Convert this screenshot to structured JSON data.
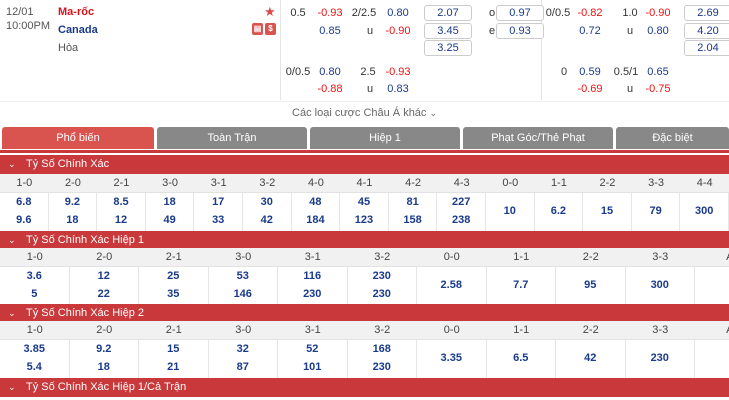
{
  "match": {
    "date": "12/01",
    "time": "10:00PM",
    "home": "Ma-rốc",
    "away": "Canada",
    "draw": "Hòa",
    "badge1": "▤",
    "badge2": "$"
  },
  "odds_block1": {
    "r1": [
      "0.5",
      "-0.93",
      "2/2.5",
      "0.80",
      "2.07",
      "o",
      "0.97"
    ],
    "r2": [
      "0.85",
      "u",
      "-0.90",
      "3.45",
      "e",
      "0.93"
    ],
    "r3": [
      "3.25"
    ],
    "r4": [
      "0/0.5",
      "0.80",
      "2.5",
      "-0.93"
    ],
    "r5": [
      "-0.88",
      "u",
      "0.83"
    ]
  },
  "odds_block2": {
    "r1": [
      "0/0.5",
      "-0.82",
      "1.0",
      "-0.90",
      "2.69"
    ],
    "r2": [
      "0.72",
      "u",
      "0.80",
      "4.20"
    ],
    "r3": [
      "2.04"
    ],
    "r4": [
      "0",
      "0.59",
      "0.5/1",
      "0.65"
    ],
    "r5": [
      "-0.69",
      "u",
      "-0.75"
    ]
  },
  "more_label": "Các loại cược Châu Á khác",
  "tabs": [
    "Phổ biến",
    "Toàn Trận",
    "Hiệp 1",
    "Phạt Góc/Thẻ Phạt",
    "Đặc biệt"
  ],
  "sections": [
    {
      "title": "Tỷ Số Chính Xác",
      "headers": [
        "1-0",
        "2-0",
        "2-1",
        "3-0",
        "3-1",
        "3-2",
        "4-0",
        "4-1",
        "4-2",
        "4-3",
        "0-0",
        "1-1",
        "2-2",
        "3-3",
        "4-4"
      ],
      "top": [
        "6.8",
        "9.2",
        "8.5",
        "18",
        "17",
        "30",
        "48",
        "45",
        "81",
        "227",
        "",
        "",
        "",
        "",
        ""
      ],
      "bottom": [
        "9.6",
        "18",
        "12",
        "49",
        "33",
        "42",
        "184",
        "123",
        "158",
        "238",
        "",
        "",
        "",
        "",
        ""
      ],
      "mid": [
        "",
        "",
        "",
        "",
        "",
        "",
        "",
        "",
        "",
        "",
        "10",
        "6.2",
        "15",
        "79",
        "300"
      ]
    },
    {
      "title": "Tỷ Số Chính Xác Hiệp 1",
      "headers": [
        "1-0",
        "2-0",
        "2-1",
        "3-0",
        "3-1",
        "3-2",
        "0-0",
        "1-1",
        "2-2",
        "3-3",
        "A"
      ],
      "top": [
        "3.6",
        "12",
        "25",
        "53",
        "116",
        "230",
        "",
        "",
        "",
        "",
        ""
      ],
      "bottom": [
        "5",
        "22",
        "35",
        "146",
        "230",
        "230",
        "",
        "",
        "",
        "",
        ""
      ],
      "mid": [
        "",
        "",
        "",
        "",
        "",
        "",
        "2.58",
        "7.7",
        "95",
        "300",
        ""
      ]
    },
    {
      "title": "Tỷ Số Chính Xác Hiệp 2",
      "headers": [
        "1-0",
        "2-0",
        "2-1",
        "3-0",
        "3-1",
        "3-2",
        "0-0",
        "1-1",
        "2-2",
        "3-3",
        "A"
      ],
      "top": [
        "3.85",
        "9.2",
        "15",
        "32",
        "52",
        "168",
        "",
        "",
        "",
        "",
        ""
      ],
      "bottom": [
        "5.4",
        "18",
        "21",
        "87",
        "101",
        "230",
        "",
        "",
        "",
        "",
        ""
      ],
      "mid": [
        "",
        "",
        "",
        "",
        "",
        "",
        "3.35",
        "6.5",
        "42",
        "230",
        ""
      ]
    },
    {
      "title": "Tỷ Số Chính Xác Hiệp 1/Cả Trận"
    }
  ]
}
